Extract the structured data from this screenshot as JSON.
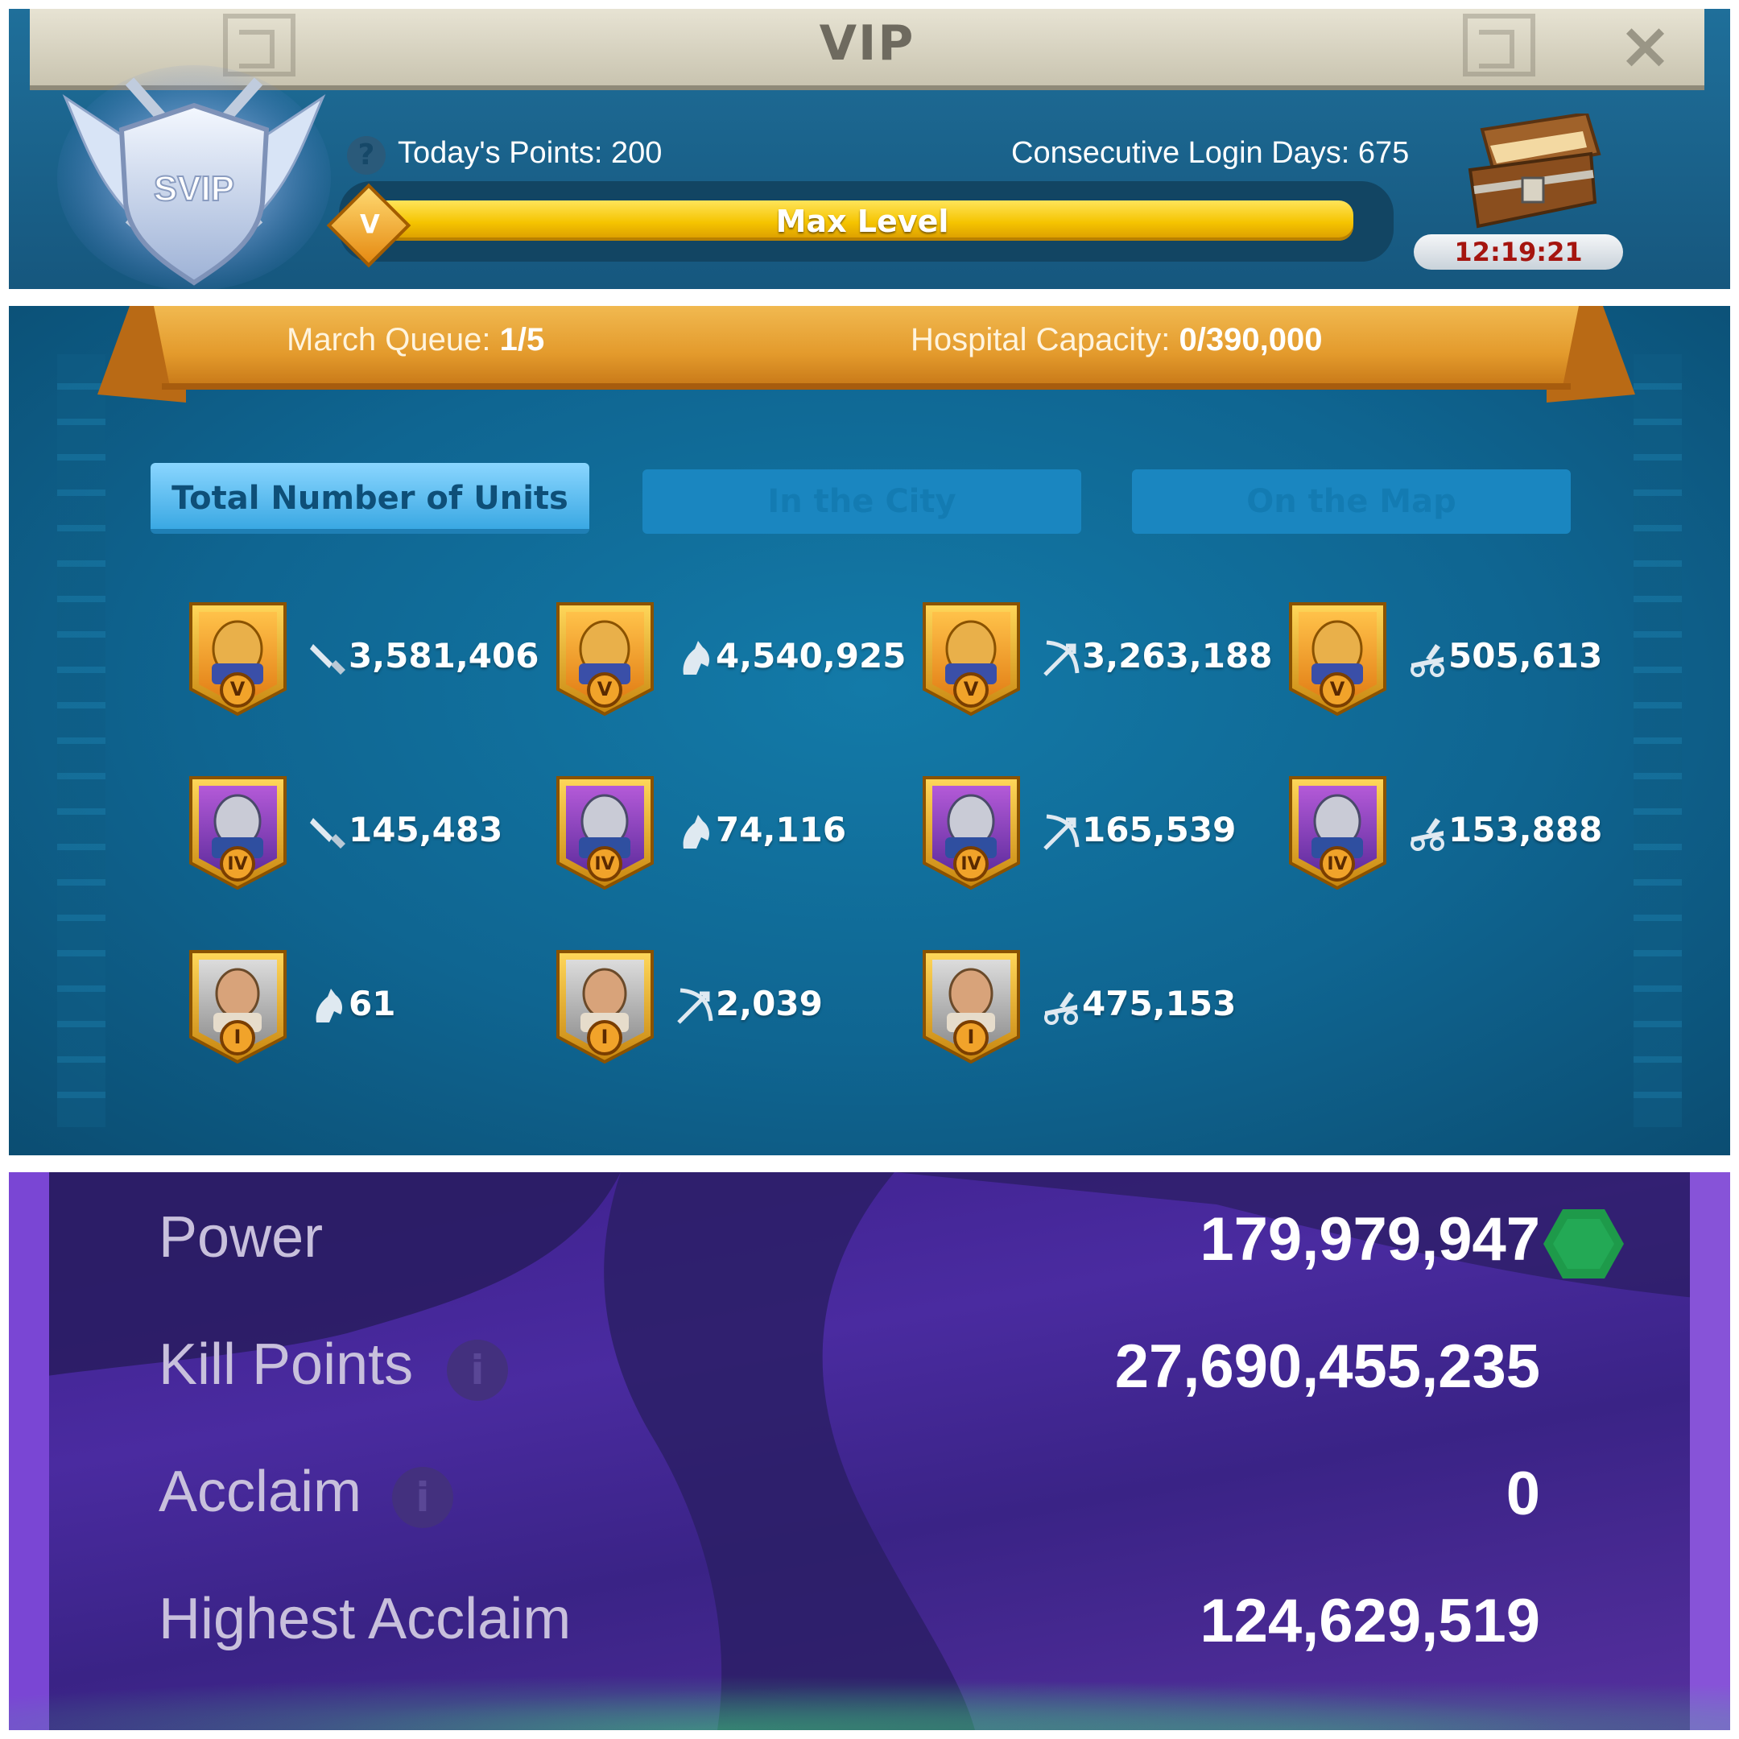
{
  "vip": {
    "title": "VIP",
    "badge_text": "SVIP",
    "help_icon": "?",
    "todays_points": "Today's Points: 200",
    "login_days": "Consecutive Login Days: 675",
    "progress_label": "Max Level",
    "progress_fraction": 1.0,
    "gem_text": "V",
    "chest_timer": "12:19:21"
  },
  "troops": {
    "march_queue_label": "March Queue: ",
    "march_queue_value": "1/5",
    "hospital_label": "Hospital Capacity: ",
    "hospital_value": "0/390,000",
    "tabs": [
      {
        "label": "Total Number of Units",
        "active": true
      },
      {
        "label": "In the City",
        "active": false
      },
      {
        "label": "On the Map",
        "active": false
      }
    ],
    "units": [
      {
        "type": "infantry-icon",
        "tier": "V",
        "count": "3,581,406"
      },
      {
        "type": "cavalry-icon",
        "tier": "V",
        "count": "4,540,925"
      },
      {
        "type": "archer-icon",
        "tier": "V",
        "count": "3,263,188"
      },
      {
        "type": "siege-icon",
        "tier": "V",
        "count": "505,613"
      },
      {
        "type": "infantry-icon",
        "tier": "IV",
        "count": "145,483"
      },
      {
        "type": "cavalry-icon",
        "tier": "IV",
        "count": "74,116"
      },
      {
        "type": "archer-icon",
        "tier": "IV",
        "count": "165,539"
      },
      {
        "type": "siege-icon",
        "tier": "IV",
        "count": "153,888"
      },
      {
        "type": "cavalry-icon",
        "tier": "I",
        "count": "61"
      },
      {
        "type": "archer-icon",
        "tier": "I",
        "count": "2,039"
      },
      {
        "type": "siege-icon",
        "tier": "I",
        "count": "475,153"
      }
    ]
  },
  "stats": {
    "power_label": "Power",
    "power_value": "179,979,947",
    "kill_points_label": "Kill Points",
    "kill_points_value": "27,690,455,235",
    "acclaim_label": "Acclaim",
    "acclaim_value": "0",
    "highest_acclaim_label": "Highest Acclaim",
    "highest_acclaim_value": "124,629,519",
    "info_icon": "i"
  },
  "colors": {
    "vip_bg": "#1f6f9a",
    "progress_gold": "#f5c400",
    "troop_bg": "#0f6591",
    "banner_orange": "#e9a43a",
    "active_tab": "#8ad6ff",
    "stats_purple": "#4a2ba0",
    "power_hex": "#1e9a4a",
    "timer_red": "#a5150f"
  }
}
